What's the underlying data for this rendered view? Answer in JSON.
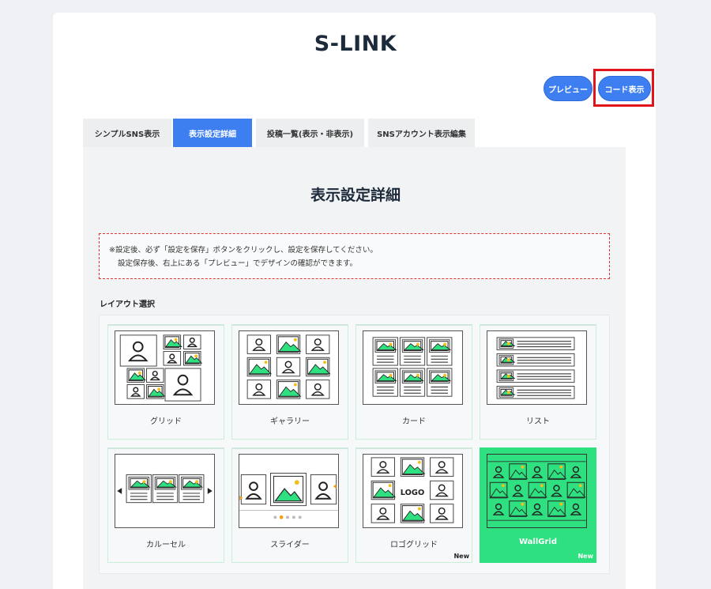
{
  "app": {
    "title": "S-LINK"
  },
  "toolbar": {
    "preview_label": "プレビュー",
    "code_label": "コード表示"
  },
  "tabs": [
    {
      "label": "シンプルSNS表示",
      "active": false
    },
    {
      "label": "表示設定詳細",
      "active": true
    },
    {
      "label": "投稿一覧(表示・非表示)",
      "active": false
    },
    {
      "label": "SNSアカウント表示編集",
      "active": false
    }
  ],
  "panel": {
    "title": "表示設定詳細",
    "notice_line1": "※設定後、必ず「設定を保存」ボタンをクリックし、設定を保存してください。",
    "notice_line2": "設定保存後、右上にある「プレビュー」でデザインの確認ができます。",
    "layout_label": "レイアウト選択"
  },
  "layouts": [
    {
      "label": "グリッド",
      "badge": "",
      "selected": false
    },
    {
      "label": "ギャラリー",
      "badge": "",
      "selected": false
    },
    {
      "label": "カード",
      "badge": "",
      "selected": false
    },
    {
      "label": "リスト",
      "badge": "",
      "selected": false
    },
    {
      "label": "カルーセル",
      "badge": "",
      "selected": false
    },
    {
      "label": "スライダー",
      "badge": "",
      "selected": false
    },
    {
      "label": "ロゴグリッド",
      "badge": "New",
      "selected": false,
      "logo_text": "LOGO"
    },
    {
      "label": "WallGrid",
      "badge": "New",
      "selected": true
    }
  ],
  "colors": {
    "accent": "#3d7ff0",
    "selected": "#2ee07f",
    "highlight": "#e0151c",
    "image_green": "#2ee07f",
    "sun": "#f2c019",
    "orange_dot": "#f0a01a"
  }
}
